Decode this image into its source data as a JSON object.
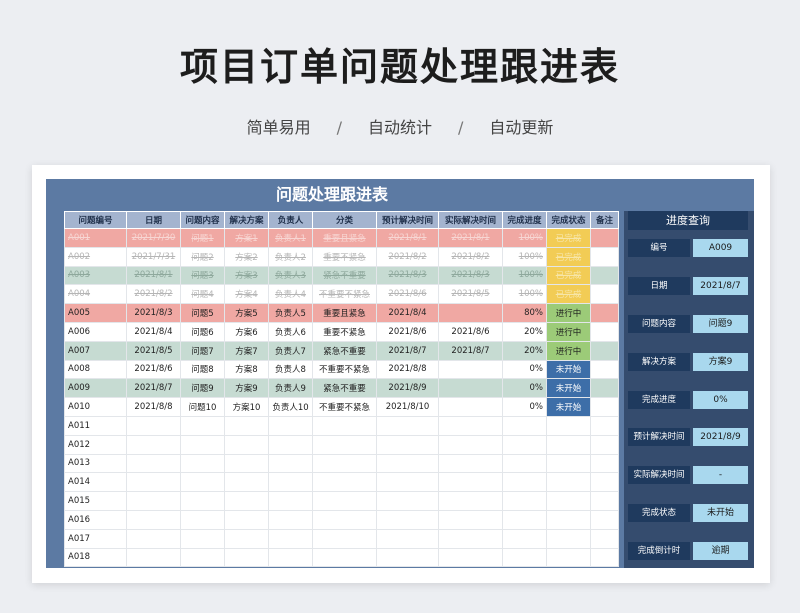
{
  "page": {
    "title": "项目订单问题处理跟进表",
    "subtitle_items": [
      "简单易用",
      "自动统计",
      "自动更新"
    ],
    "separator": "/"
  },
  "table": {
    "title": "问题处理跟进表",
    "headers": [
      "问题编号",
      "日期",
      "问题内容",
      "解决方案",
      "负责人",
      "分类",
      "预计解决时间",
      "实际解决时间",
      "完成进度",
      "完成状态",
      "备注"
    ],
    "rows": [
      {
        "cells": [
          "A001",
          "2021/7/30",
          "问题1",
          "方案1",
          "负责人1",
          "重要且紧急",
          "2021/8/1",
          "2021/8/1",
          "100%",
          "已完成",
          ""
        ],
        "row_color": "red",
        "status": "done"
      },
      {
        "cells": [
          "A002",
          "2021/7/31",
          "问题2",
          "方案2",
          "负责人2",
          "重要不紧急",
          "2021/8/2",
          "2021/8/2",
          "100%",
          "已完成",
          ""
        ],
        "row_color": "white",
        "status": "done"
      },
      {
        "cells": [
          "A003",
          "2021/8/1",
          "问题3",
          "方案3",
          "负责人3",
          "紧急不重要",
          "2021/8/3",
          "2021/8/3",
          "100%",
          "已完成",
          ""
        ],
        "row_color": "green",
        "status": "done"
      },
      {
        "cells": [
          "A004",
          "2021/8/2",
          "问题4",
          "方案4",
          "负责人4",
          "不重要不紧急",
          "2021/8/6",
          "2021/8/5",
          "100%",
          "已完成",
          ""
        ],
        "row_color": "white",
        "status": "done"
      },
      {
        "cells": [
          "A005",
          "2021/8/3",
          "问题5",
          "方案5",
          "负责人5",
          "重要且紧急",
          "2021/8/4",
          "",
          "80%",
          "进行中",
          ""
        ],
        "row_color": "red",
        "status": "progress"
      },
      {
        "cells": [
          "A006",
          "2021/8/4",
          "问题6",
          "方案6",
          "负责人6",
          "重要不紧急",
          "2021/8/6",
          "2021/8/6",
          "20%",
          "进行中",
          ""
        ],
        "row_color": "white",
        "status": "progress"
      },
      {
        "cells": [
          "A007",
          "2021/8/5",
          "问题7",
          "方案7",
          "负责人7",
          "紧急不重要",
          "2021/8/7",
          "2021/8/7",
          "20%",
          "进行中",
          ""
        ],
        "row_color": "green",
        "status": "progress"
      },
      {
        "cells": [
          "A008",
          "2021/8/6",
          "问题8",
          "方案8",
          "负责人8",
          "不重要不紧急",
          "2021/8/8",
          "",
          "0%",
          "未开始",
          ""
        ],
        "row_color": "white",
        "status": "notstart"
      },
      {
        "cells": [
          "A009",
          "2021/8/7",
          "问题9",
          "方案9",
          "负责人9",
          "紧急不重要",
          "2021/8/9",
          "",
          "0%",
          "未开始",
          ""
        ],
        "row_color": "green",
        "status": "notstart"
      },
      {
        "cells": [
          "A010",
          "2021/8/8",
          "问题10",
          "方案10",
          "负责人10",
          "不重要不紧急",
          "2021/8/10",
          "",
          "0%",
          "未开始",
          ""
        ],
        "row_color": "white",
        "status": "notstart"
      },
      {
        "cells": [
          "A011",
          "",
          "",
          "",
          "",
          "",
          "",
          "",
          "",
          "",
          ""
        ],
        "row_color": "white",
        "status": "none"
      },
      {
        "cells": [
          "A012",
          "",
          "",
          "",
          "",
          "",
          "",
          "",
          "",
          "",
          ""
        ],
        "row_color": "white",
        "status": "none"
      },
      {
        "cells": [
          "A013",
          "",
          "",
          "",
          "",
          "",
          "",
          "",
          "",
          "",
          ""
        ],
        "row_color": "white",
        "status": "none"
      },
      {
        "cells": [
          "A014",
          "",
          "",
          "",
          "",
          "",
          "",
          "",
          "",
          "",
          ""
        ],
        "row_color": "white",
        "status": "none"
      },
      {
        "cells": [
          "A015",
          "",
          "",
          "",
          "",
          "",
          "",
          "",
          "",
          "",
          ""
        ],
        "row_color": "white",
        "status": "none"
      },
      {
        "cells": [
          "A016",
          "",
          "",
          "",
          "",
          "",
          "",
          "",
          "",
          "",
          ""
        ],
        "row_color": "white",
        "status": "none"
      },
      {
        "cells": [
          "A017",
          "",
          "",
          "",
          "",
          "",
          "",
          "",
          "",
          "",
          ""
        ],
        "row_color": "white",
        "status": "none"
      },
      {
        "cells": [
          "A018",
          "",
          "",
          "",
          "",
          "",
          "",
          "",
          "",
          "",
          ""
        ],
        "row_color": "white",
        "status": "none"
      }
    ]
  },
  "query": {
    "title": "进度查询",
    "fields": [
      {
        "label": "编号",
        "value": "A009"
      },
      {
        "label": "日期",
        "value": "2021/8/7"
      },
      {
        "label": "问题内容",
        "value": "问题9"
      },
      {
        "label": "解决方案",
        "value": "方案9"
      },
      {
        "label": "完成进度",
        "value": "0%"
      },
      {
        "label": "预计解决时间",
        "value": "2021/8/9"
      },
      {
        "label": "实际解决时间",
        "value": "-"
      },
      {
        "label": "完成状态",
        "value": "未开始"
      },
      {
        "label": "完成倒计时",
        "value": "逾期"
      }
    ]
  },
  "colors": {
    "panel_bg": "#5c7aa3",
    "header_bg": "#a4b4cf",
    "row_red": "#f0a8a3",
    "row_green": "#c6dbd2",
    "status_done": "#f2cc55",
    "status_progress": "#9ccb78",
    "status_notstart": "#3d6ea8",
    "query_label_bg": "#1f3a5e",
    "query_value_bg": "#a9d8ee"
  }
}
